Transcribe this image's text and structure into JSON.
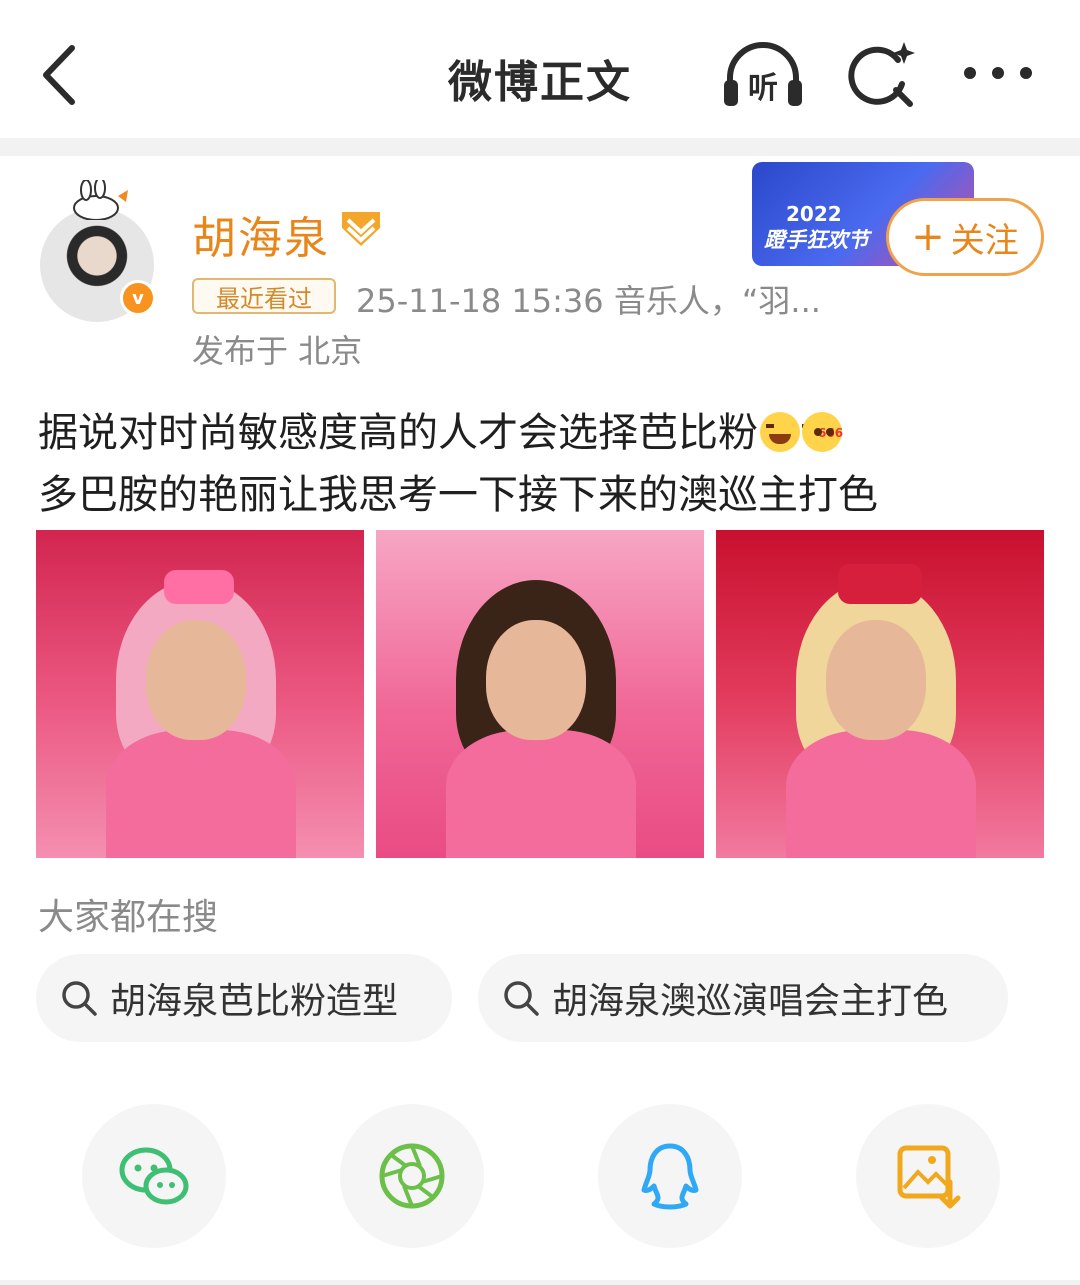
{
  "header": {
    "title": "微博正文",
    "listen_label": "听"
  },
  "author": {
    "name": "胡海泉",
    "verified_mark": "v",
    "recent_tag": "最近看过",
    "meta": "25-11-18 15:36  音乐人，“羽...",
    "location": "发布于 北京",
    "event_banner": {
      "year": "2022",
      "name": "蹬手狂欢节"
    },
    "follow_label": "关注",
    "follow_plus": "+"
  },
  "post": {
    "line1": "据说对时尚敏感度高的人才会选择芭比粉",
    "line2": "多巴胺的艳丽让我思考一下接下来的澳巡主打色",
    "images_count_visible": 3
  },
  "search_suggestions": {
    "title": "大家都在搜",
    "items": [
      "胡海泉芭比粉造型",
      "胡海泉澳巡演唱会主打色"
    ]
  },
  "share": {
    "items": [
      "wechat-icon",
      "moments-icon",
      "qq-icon",
      "save-image-icon"
    ]
  },
  "colors": {
    "accent": "#e8861a",
    "follow_border": "#f0a34b",
    "wechat": "#3fbf73",
    "moments": "#6cc04a",
    "qq": "#2fa8f5",
    "save": "#f2a81d"
  }
}
